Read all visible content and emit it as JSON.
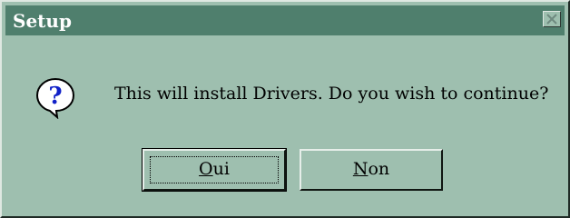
{
  "window": {
    "title": "Setup"
  },
  "dialog": {
    "message": "This will install Drivers. Do you wish to continue?",
    "icon": "question-icon"
  },
  "buttons": {
    "yes": {
      "mnemonic": "O",
      "rest": "ui"
    },
    "no": {
      "mnemonic": "N",
      "rest": "on"
    }
  },
  "colors": {
    "titlebar": "#4f7f6d",
    "face": "#9ebfaf",
    "icon_blue": "#1020c8"
  }
}
